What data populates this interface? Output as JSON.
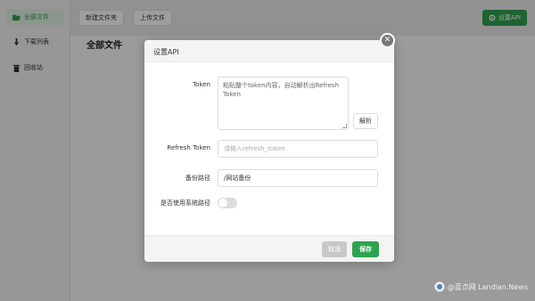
{
  "sidebar": {
    "items": [
      {
        "label": "全部文件",
        "icon": "folder-open-icon",
        "active": true
      },
      {
        "label": "下载列表",
        "icon": "download-icon",
        "active": false
      },
      {
        "label": "回收站",
        "icon": "trash-icon",
        "active": false
      }
    ]
  },
  "toolbar": {
    "new_folder_label": "新建文件夹",
    "upload_label": "上传文件",
    "settings_api_label": "设置API"
  },
  "main": {
    "title": "全部文件"
  },
  "dialog": {
    "title": "设置API",
    "token_label": "Token",
    "token_placeholder": "粘贴整个token内容，自动解析出Refresh Token",
    "parse_label": "解析",
    "refresh_token_label": "Refresh Token",
    "refresh_token_placeholder": "请输入refresh_token",
    "backup_path_label": "备份路径",
    "backup_path_value": "/网站备份",
    "use_system_path_label": "是否使用系统路径",
    "use_system_path_on": false,
    "cancel_label": "取消",
    "save_label": "保存"
  },
  "watermark": {
    "text": "@蓝点网 Landian.News"
  },
  "colors": {
    "accent": "#2fa24f",
    "active_bg": "#e1f3e6"
  }
}
